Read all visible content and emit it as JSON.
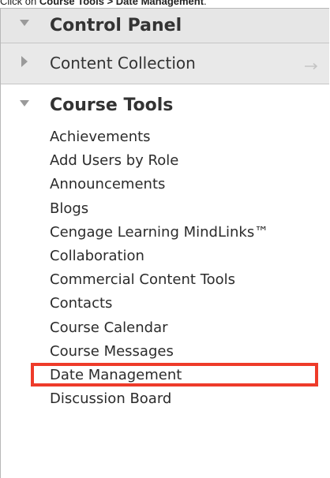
{
  "caption": {
    "prefix": "Click on ",
    "path_start": "Course Tools",
    "separator": " > ",
    "path_end": "Date Management",
    "suffix": "."
  },
  "control_panel": {
    "label": "Control Panel"
  },
  "content_collection": {
    "label": "Content Collection"
  },
  "course_tools": {
    "label": "Course Tools",
    "items": [
      "Achievements",
      "Add Users by Role",
      "Announcements",
      "Blogs",
      "Cengage Learning MindLinks™",
      "Collaboration",
      "Commercial Content Tools",
      "Contacts",
      "Course Calendar",
      "Course Messages",
      "Date Management",
      "Discussion Board"
    ],
    "highlighted_item": "Date Management"
  },
  "colors": {
    "highlight": "#ee3b2a",
    "header_bg": "#e9e9e9"
  }
}
